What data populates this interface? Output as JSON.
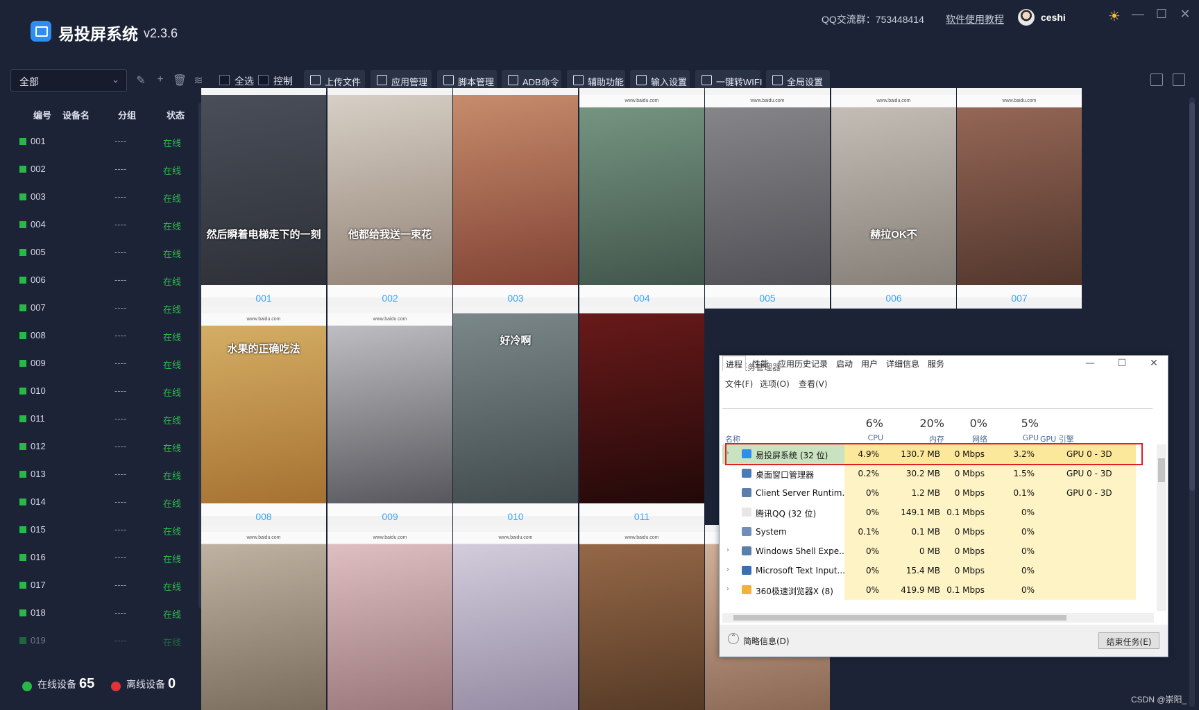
{
  "app": {
    "title": "易投屏系统",
    "version": "v2.3.6",
    "qq_group": "QQ交流群：753448414",
    "tutorial_link": "软件使用教程",
    "username": "ceshi"
  },
  "sidebar": {
    "group_select": "全部",
    "columns": {
      "id": "编号",
      "name": "设备名",
      "group": "分组",
      "status": "状态"
    },
    "devices": [
      {
        "id": "001",
        "group": "----",
        "status": "在线"
      },
      {
        "id": "002",
        "group": "----",
        "status": "在线"
      },
      {
        "id": "003",
        "group": "----",
        "status": "在线"
      },
      {
        "id": "004",
        "group": "----",
        "status": "在线"
      },
      {
        "id": "005",
        "group": "----",
        "status": "在线"
      },
      {
        "id": "006",
        "group": "----",
        "status": "在线"
      },
      {
        "id": "007",
        "group": "----",
        "status": "在线"
      },
      {
        "id": "008",
        "group": "----",
        "status": "在线"
      },
      {
        "id": "009",
        "group": "----",
        "status": "在线"
      },
      {
        "id": "010",
        "group": "----",
        "status": "在线"
      },
      {
        "id": "011",
        "group": "----",
        "status": "在线"
      },
      {
        "id": "012",
        "group": "----",
        "status": "在线"
      },
      {
        "id": "013",
        "group": "----",
        "status": "在线"
      },
      {
        "id": "014",
        "group": "----",
        "status": "在线"
      },
      {
        "id": "015",
        "group": "----",
        "status": "在线"
      },
      {
        "id": "016",
        "group": "----",
        "status": "在线"
      },
      {
        "id": "017",
        "group": "----",
        "status": "在线"
      },
      {
        "id": "018",
        "group": "----",
        "status": "在线"
      },
      {
        "id": "019",
        "group": "----",
        "status": "在线"
      }
    ],
    "online_label": "在线设备",
    "online_count": "65",
    "offline_label": "离线设备",
    "offline_count": "0"
  },
  "toolbar": {
    "select_all": "全选",
    "control": "控制",
    "buttons": [
      "上传文件",
      "应用管理",
      "脚本管理",
      "ADB命令",
      "辅助功能",
      "输入设置",
      "一键转WIFI",
      "全局设置"
    ]
  },
  "grid": {
    "tiles": [
      {
        "label": "001",
        "subtitle": "然后瞬着电梯走下的一刻",
        "url": ""
      },
      {
        "label": "002",
        "subtitle": "他都给我送一束花",
        "url": ""
      },
      {
        "label": "003",
        "subtitle": "",
        "url": ""
      },
      {
        "label": "004",
        "subtitle": "",
        "url": "www.baidu.com"
      },
      {
        "label": "005",
        "subtitle": "",
        "url": "www.baidu.com"
      },
      {
        "label": "006",
        "subtitle": "赫拉OK不",
        "url": "www.baidu.com"
      },
      {
        "label": "007",
        "subtitle": "",
        "url": "www.baidu.com"
      },
      {
        "label": "008",
        "subtitle": "水果的正确吃法",
        "url": "www.baidu.com"
      },
      {
        "label": "009",
        "subtitle": "",
        "url": "www.baidu.com"
      },
      {
        "label": "010",
        "subtitle": "好冷啊",
        "url": ""
      },
      {
        "label": "011",
        "subtitle": "",
        "url": ""
      },
      {
        "label": "",
        "subtitle": "",
        "url": "www.baidu.com"
      },
      {
        "label": "",
        "subtitle": "",
        "url": "www.baidu.com"
      },
      {
        "label": "",
        "subtitle": "",
        "url": "www.baidu.com"
      },
      {
        "label": "",
        "subtitle": "",
        "url": "www.baidu.com"
      },
      {
        "label": "",
        "subtitle": "",
        "url": "www.baidu.com"
      }
    ]
  },
  "task_manager": {
    "title": "任务管理器",
    "menu": [
      "文件(F)",
      "选项(O)",
      "查看(V)"
    ],
    "tabs": [
      "进程",
      "性能",
      "应用历史记录",
      "启动",
      "用户",
      "详细信息",
      "服务"
    ],
    "headers": {
      "name": "名称",
      "cpu_pct": "6%",
      "cpu": "CPU",
      "mem_pct": "20%",
      "mem": "内存",
      "net_pct": "0%",
      "net": "网络",
      "gpu_pct": "5%",
      "gpu": "GPU",
      "gpu_engine": "GPU 引擎"
    },
    "rows": [
      {
        "name": "易投屏系统 (32 位)",
        "cpu": "4.9%",
        "mem": "130.7 MB",
        "net": "0 Mbps",
        "gpu": "3.2%",
        "engine": "GPU 0 - 3D"
      },
      {
        "name": "桌面窗口管理器",
        "cpu": "0.2%",
        "mem": "30.2 MB",
        "net": "0 Mbps",
        "gpu": "1.5%",
        "engine": "GPU 0 - 3D"
      },
      {
        "name": "Client Server Runtim...",
        "cpu": "0%",
        "mem": "1.2 MB",
        "net": "0 Mbps",
        "gpu": "0.1%",
        "engine": "GPU 0 - 3D"
      },
      {
        "name": "腾讯QQ (32 位)",
        "cpu": "0%",
        "mem": "149.1 MB",
        "net": "0.1 Mbps",
        "gpu": "0%",
        "engine": ""
      },
      {
        "name": "System",
        "cpu": "0.1%",
        "mem": "0.1 MB",
        "net": "0 Mbps",
        "gpu": "0%",
        "engine": ""
      },
      {
        "name": "Windows Shell Expe...",
        "cpu": "0%",
        "mem": "0 MB",
        "net": "0 Mbps",
        "gpu": "0%",
        "engine": ""
      },
      {
        "name": "Microsoft Text Input...",
        "cpu": "0%",
        "mem": "15.4 MB",
        "net": "0 Mbps",
        "gpu": "0%",
        "engine": ""
      },
      {
        "name": "360极速浏览器X (8)",
        "cpu": "0%",
        "mem": "419.9 MB",
        "net": "0.1 Mbps",
        "gpu": "0%",
        "engine": ""
      }
    ],
    "brief_info": "简略信息(D)",
    "end_task": "结束任务(E)"
  },
  "watermark": "CSDN @崇阳_"
}
